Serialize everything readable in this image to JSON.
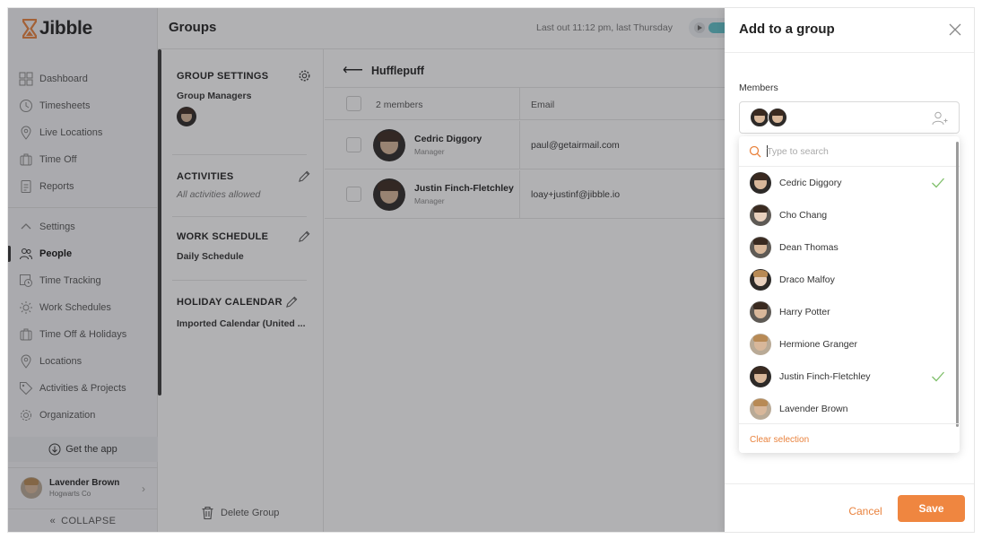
{
  "app": {
    "brand": "Jibble",
    "brand_color": "#e9823d"
  },
  "sidebar": {
    "items": [
      {
        "label": "Dashboard",
        "icon": "dashboard-icon"
      },
      {
        "label": "Timesheets",
        "icon": "clock-icon"
      },
      {
        "label": "Live Locations",
        "icon": "location-pin-icon"
      },
      {
        "label": "Time Off",
        "icon": "suitcase-icon"
      },
      {
        "label": "Reports",
        "icon": "report-icon"
      },
      {
        "label": "Settings",
        "icon": "chevron-up-icon"
      },
      {
        "label": "People",
        "icon": "people-icon"
      },
      {
        "label": "Time Tracking",
        "icon": "time-tracking-icon"
      },
      {
        "label": "Work Schedules",
        "icon": "schedule-icon"
      },
      {
        "label": "Time Off & Holidays",
        "icon": "suitcase-icon"
      },
      {
        "label": "Locations",
        "icon": "location-pin-icon"
      },
      {
        "label": "Activities & Projects",
        "icon": "tag-icon"
      },
      {
        "label": "Organization",
        "icon": "gear-icon"
      }
    ],
    "active_item": "People",
    "get_app": "Get the app",
    "user": {
      "name": "Lavender Brown",
      "org": "Hogwarts Co"
    },
    "collapse": "COLLAPSE"
  },
  "header": {
    "title": "Groups",
    "last_out": "Last out 11:12 pm, last Thursday"
  },
  "group_settings": {
    "title": "GROUP SETTINGS",
    "managers_label": "Group Managers",
    "activities": {
      "title": "ACTIVITIES",
      "value": "All activities allowed"
    },
    "work_schedule": {
      "title": "WORK SCHEDULE",
      "value": "Daily Schedule"
    },
    "holiday_calendar": {
      "title": "HOLIDAY CALENDAR",
      "value": "Imported Calendar (United ..."
    },
    "delete_label": "Delete Group"
  },
  "group": {
    "name": "Hufflepuff",
    "members_count": "2 members",
    "email_header": "Email",
    "rows": [
      {
        "name": "Cedric Diggory",
        "role": "Manager",
        "email": "paul@getairmail.com"
      },
      {
        "name": "Justin Finch-Fletchley",
        "role": "Manager",
        "email": "loay+justinf@jibble.io"
      }
    ]
  },
  "drawer": {
    "title": "Add to a group",
    "members_label": "Members",
    "search_placeholder": "Type to search",
    "options": [
      {
        "name": "Cedric Diggory",
        "selected": true
      },
      {
        "name": "Cho Chang",
        "selected": false
      },
      {
        "name": "Dean Thomas",
        "selected": false
      },
      {
        "name": "Draco Malfoy",
        "selected": false
      },
      {
        "name": "Harry Potter",
        "selected": false
      },
      {
        "name": "Hermione Granger",
        "selected": false
      },
      {
        "name": "Justin Finch-Fletchley",
        "selected": true
      },
      {
        "name": "Lavender Brown",
        "selected": false
      }
    ],
    "clear_selection": "Clear selection",
    "cancel": "Cancel",
    "save": "Save"
  }
}
